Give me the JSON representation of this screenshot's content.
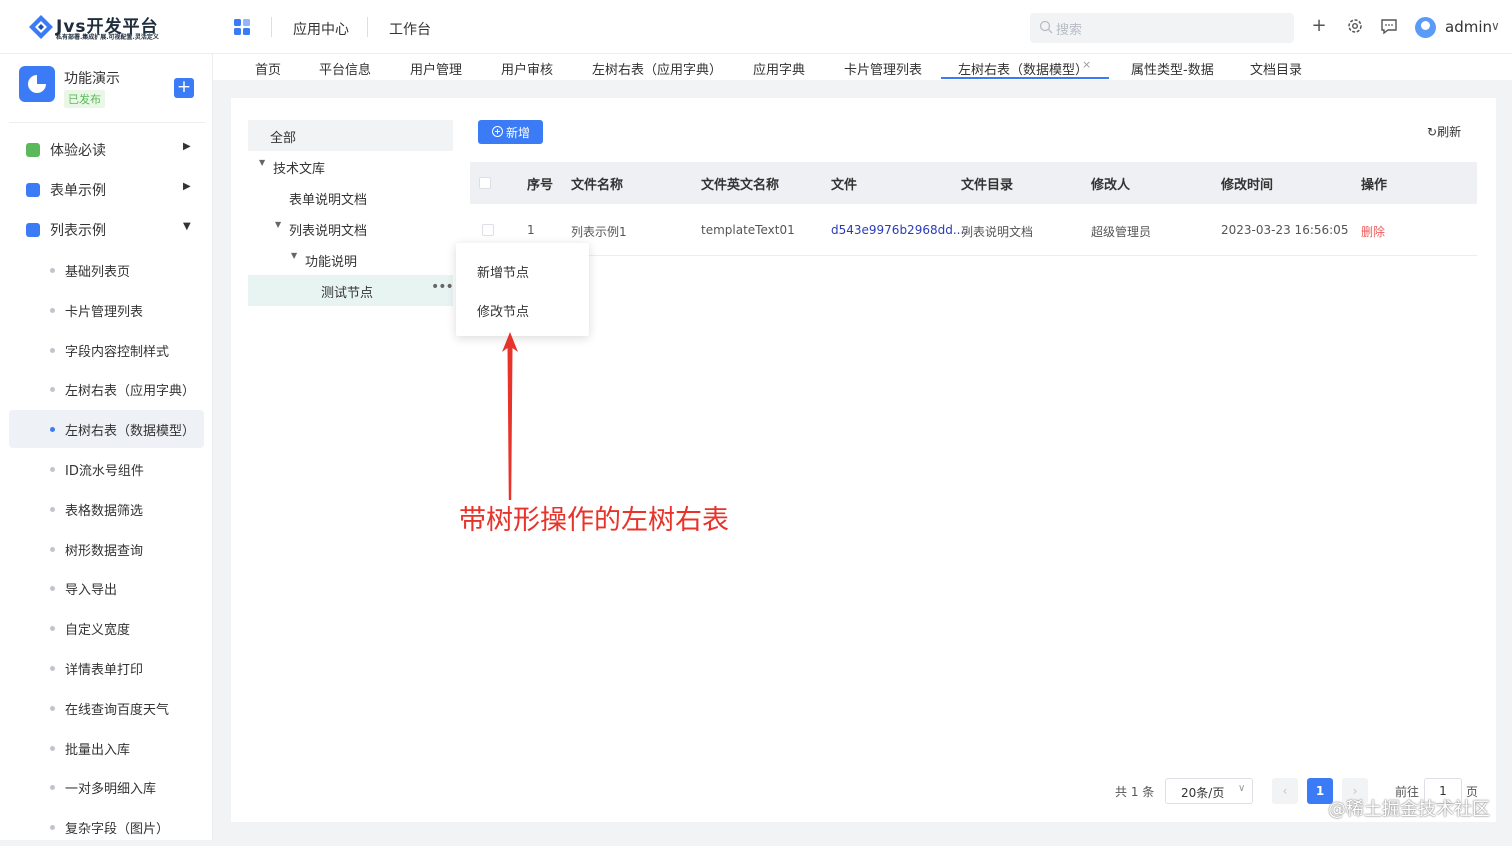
{
  "header": {
    "logo_title": "Jvs开发平台",
    "logo_subtitle": "私有部署.集成扩展.可视配置.灵活定义",
    "nav": [
      "应用中心",
      "工作台"
    ],
    "search_placeholder": "搜索",
    "username": "admin",
    "icons": [
      "apps-grid-icon",
      "plus-icon",
      "gear-icon",
      "message-icon",
      "user-avatar-icon",
      "chevron-down-icon"
    ]
  },
  "sidebar": {
    "app_name": "功能演示",
    "app_status": "已发布",
    "groups": [
      {
        "label": "体验必读",
        "color": "#5bb95b",
        "arrow": "▶"
      },
      {
        "label": "表单示例",
        "color": "#3b7cf6",
        "arrow": "▶"
      },
      {
        "label": "列表示例",
        "color": "#3b7cf6",
        "arrow": "▼"
      }
    ],
    "items": [
      "基础列表页",
      "卡片管理列表",
      "字段内容控制样式",
      "左树右表（应用字典）",
      "左树右表（数据模型）",
      "ID流水号组件",
      "表格数据筛选",
      "树形数据查询",
      "导入导出",
      "自定义宽度",
      "详情表单打印",
      "在线查询百度天气",
      "批量出入库",
      "一对多明细入库",
      "复杂字段（图片）"
    ],
    "active_item": "左树右表（数据模型）"
  },
  "tabs": {
    "items": [
      "首页",
      "平台信息",
      "用户管理",
      "用户审核",
      "左树右表（应用字典）",
      "应用字典",
      "卡片管理列表",
      "左树右表（数据模型）",
      "属性类型-数据",
      "文档目录"
    ],
    "active": "左树右表（数据模型）",
    "close": "×"
  },
  "tree": {
    "all": "全部",
    "nodes": [
      {
        "label": "技术文库",
        "level": 1,
        "expanded": true
      },
      {
        "label": "表单说明文档",
        "level": 2,
        "expanded": false
      },
      {
        "label": "列表说明文档",
        "level": 2,
        "expanded": true
      },
      {
        "label": "功能说明",
        "level": 3,
        "expanded": true
      },
      {
        "label": "测试节点",
        "level": 4,
        "selected": true
      }
    ],
    "more": "•••"
  },
  "toolbar": {
    "add_label": "新增",
    "refresh_label": "刷新"
  },
  "table": {
    "columns": [
      "序号",
      "文件名称",
      "文件英文名称",
      "文件",
      "文件目录",
      "修改人",
      "修改时间",
      "操作"
    ],
    "rows": [
      {
        "index": "1",
        "name": "列表示例1",
        "en_name": "templateText01",
        "file": "d543e9976b2968dd...",
        "dir": "列表说明文档",
        "modifier": "超级管理员",
        "time": "2023-03-23 16:56:05",
        "action": "删除"
      }
    ]
  },
  "context_menu": {
    "items": [
      "新增节点",
      "修改节点"
    ]
  },
  "annotation": {
    "text": "带树形操作的左树右表",
    "color": "#e8332a"
  },
  "pagination": {
    "total_text": "共 1 条",
    "page_size": "20条/页",
    "current_page": "1",
    "goto_label": "前往",
    "goto_value": "1",
    "page_unit": "页"
  },
  "watermark": "@稀土掘金技术社区",
  "colors": {
    "accent": "#3b7cf6",
    "danger": "#f05a5a",
    "link": "#2b3bb8"
  }
}
